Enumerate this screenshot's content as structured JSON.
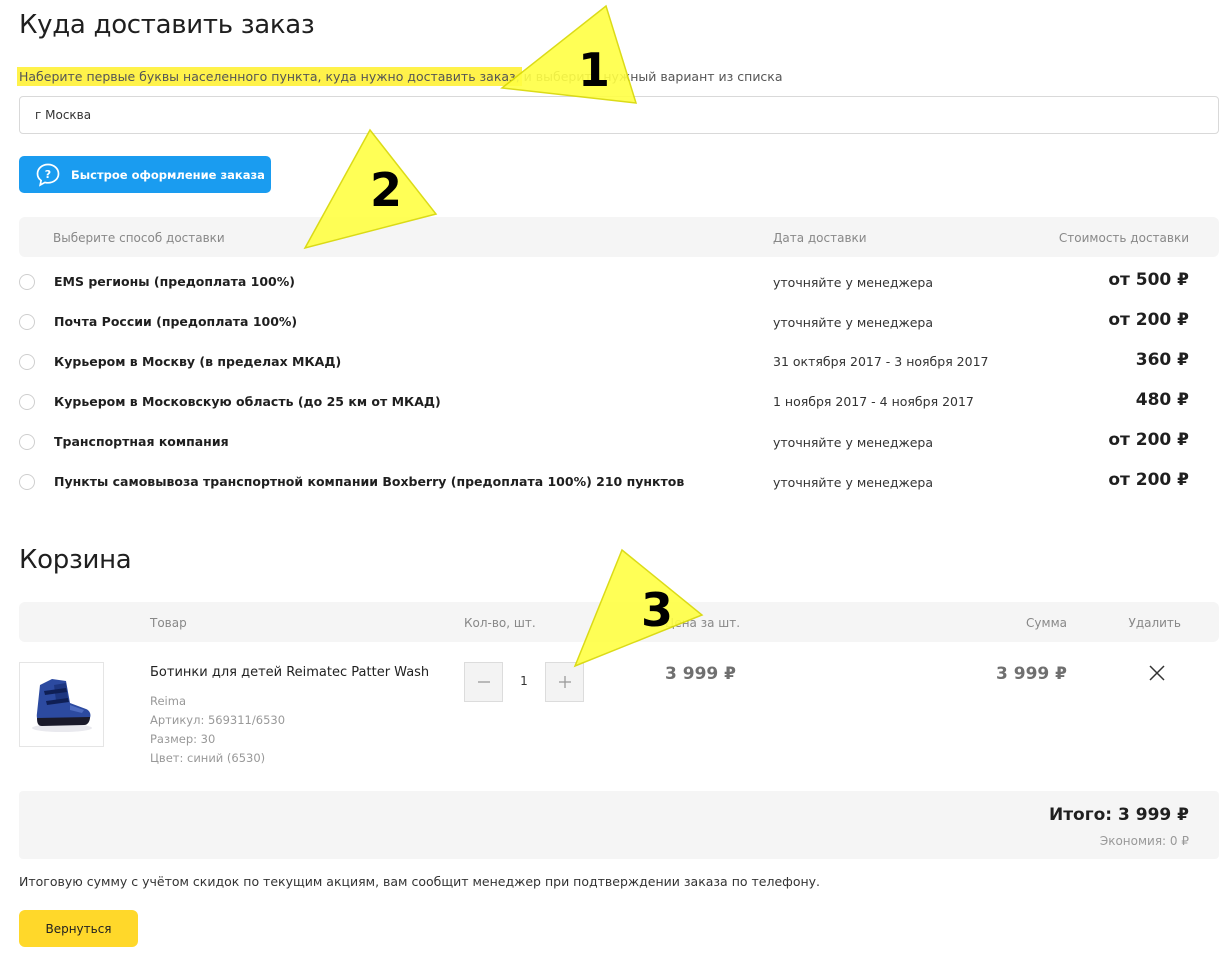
{
  "delivery": {
    "title": "Куда доставить заказ",
    "hint_highlight": "Наберите первые буквы населенного пункта, куда нужно доставить заказ,",
    "hint_rest": " и выберите нужный вариант из списка",
    "city_value": "г Москва",
    "quick_order_label": "Быстрое оформление заказа",
    "header": {
      "method": "Выберите способ доставки",
      "date": "Дата доставки",
      "cost": "Стоимость доставки"
    },
    "methods": [
      {
        "name": "EMS регионы (предоплата 100%)",
        "date": "уточняйте у менеджера",
        "price": "от 500 ₽"
      },
      {
        "name": "Почта России (предоплата 100%)",
        "date": "уточняйте у менеджера",
        "price": "от 200 ₽"
      },
      {
        "name": "Курьером в Москву (в пределах МКАД)",
        "date": "31 октября 2017 - 3 ноября 2017",
        "price": "360 ₽"
      },
      {
        "name": "Курьером в Московскую область (до 25 км от МКАД)",
        "date": "1 ноября 2017 - 4 ноября 2017",
        "price": "480 ₽"
      },
      {
        "name": "Транспортная компания",
        "date": "уточняйте у менеджера",
        "price": "от 200 ₽"
      },
      {
        "name": "Пункты самовывоза транспортной компании Boxberry (предоплата 100%) 210 пунктов",
        "date": "уточняйте у менеджера",
        "price": "от 200 ₽"
      }
    ]
  },
  "cart": {
    "title": "Корзина",
    "header": {
      "product": "Товар",
      "qty": "Кол-во, шт.",
      "unit_price": "Цена за шт.",
      "sum": "Сумма",
      "delete": "Удалить"
    },
    "item": {
      "name": "Ботинки для детей Reimatec Patter Wash",
      "brand": "Reima",
      "article": "Артикул: 569311/6530",
      "size": "Размер: 30",
      "color": "Цвет: синий (6530)",
      "qty": "1",
      "unit_price": "3 999 ₽",
      "sum": "3 999 ₽"
    },
    "total": "Итого: 3 999 ₽",
    "economy": "Экономия: 0 ₽",
    "note": "Итоговую сумму с учётом скидок по текущим акциям, вам сообщит менеджер при подтверждении заказа по телефону.",
    "back_label": "Вернуться"
  },
  "annotations": {
    "badge1": "1",
    "badge2": "2",
    "badge3": "3"
  },
  "colors": {
    "accent_blue": "#1a9cf0",
    "accent_yellow": "#ffd82a",
    "arrow_yellow": "#ffff44",
    "badge_navy": "#14145a"
  },
  "icons": {
    "quick_order": "question-bubble-icon",
    "remove": "close-icon",
    "qty_minus": "minus-icon",
    "qty_plus": "plus-icon"
  }
}
